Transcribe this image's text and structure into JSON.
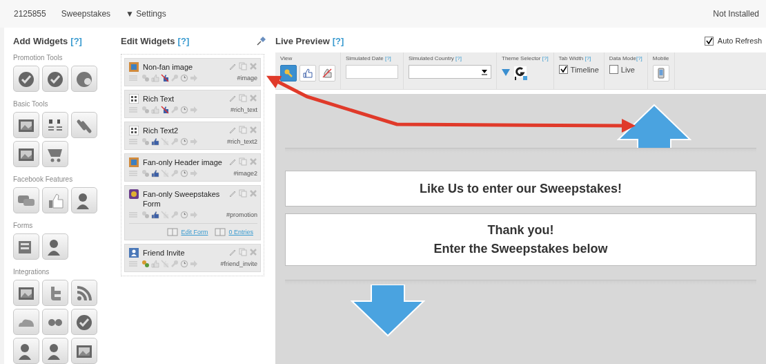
{
  "top_bar": {
    "app_id": "2125855",
    "app_type": "Sweepstakes",
    "settings_menu": "▼ Settings",
    "install_status": "Not Installed"
  },
  "add_widgets": {
    "title": "Add Widgets",
    "help": "[?]",
    "sections": [
      {
        "label": "Promotion Tools"
      },
      {
        "label": "Basic Tools"
      },
      {
        "label": "Facebook Features"
      },
      {
        "label": "Forms"
      },
      {
        "label": "Integrations"
      }
    ]
  },
  "edit_widgets": {
    "title": "Edit Widgets",
    "help": "[?]",
    "widgets": [
      {
        "kind": "image",
        "name": "Non-fan image",
        "anchor": "#image",
        "friends_on": false,
        "fans_on": false,
        "non_fans_on": true
      },
      {
        "kind": "text",
        "name": "Rich Text",
        "anchor": "#rich_text",
        "friends_on": false,
        "fans_on": false,
        "non_fans_on": true
      },
      {
        "kind": "text",
        "name": "Rich Text2",
        "anchor": "#rich_text2",
        "friends_on": false,
        "fans_on": true,
        "non_fans_on": false
      },
      {
        "kind": "image",
        "name": "Fan-only Header image",
        "anchor": "#image2",
        "friends_on": false,
        "fans_on": true,
        "non_fans_on": false
      },
      {
        "kind": "form",
        "name": "Fan-only Sweepstakes Form",
        "anchor": "#promotion",
        "friends_on": false,
        "fans_on": true,
        "non_fans_on": false,
        "links": [
          "Edit Form",
          "0 Entries"
        ]
      },
      {
        "kind": "invite",
        "name": "Friend Invite",
        "anchor": "#friend_invite",
        "friends_on": true,
        "fans_on": false,
        "non_fans_on": false
      }
    ]
  },
  "live_preview": {
    "title": "Live Preview",
    "help": "[?]",
    "auto_refresh": {
      "label": "Auto Refresh",
      "checked": true
    },
    "toolbar": {
      "view": {
        "label": "View",
        "buttons": [
          {
            "selected": true
          },
          {
            "selected": false
          },
          {
            "selected": false
          }
        ]
      },
      "simulated_date": {
        "label": "Simulated Date",
        "help": "[?]"
      },
      "simulated_country": {
        "label": "Simulated Country",
        "help": "[?]"
      },
      "theme_selector": {
        "label": "Theme Selector",
        "help": "[?]"
      },
      "tab_width": {
        "label": "Tab Width",
        "help": "[?]",
        "option": "Timeline",
        "checked": true
      },
      "data_mode": {
        "label": "Data Mode",
        "help": "[?]",
        "option": "Live",
        "checked": false
      },
      "mobile": {
        "label": "Mobile"
      }
    },
    "banners": [
      {
        "lines": [
          "Like Us to enter our Sweepstakes!"
        ]
      },
      {
        "lines": [
          "Thank you!",
          "Enter the Sweepstakes below"
        ]
      }
    ]
  }
}
